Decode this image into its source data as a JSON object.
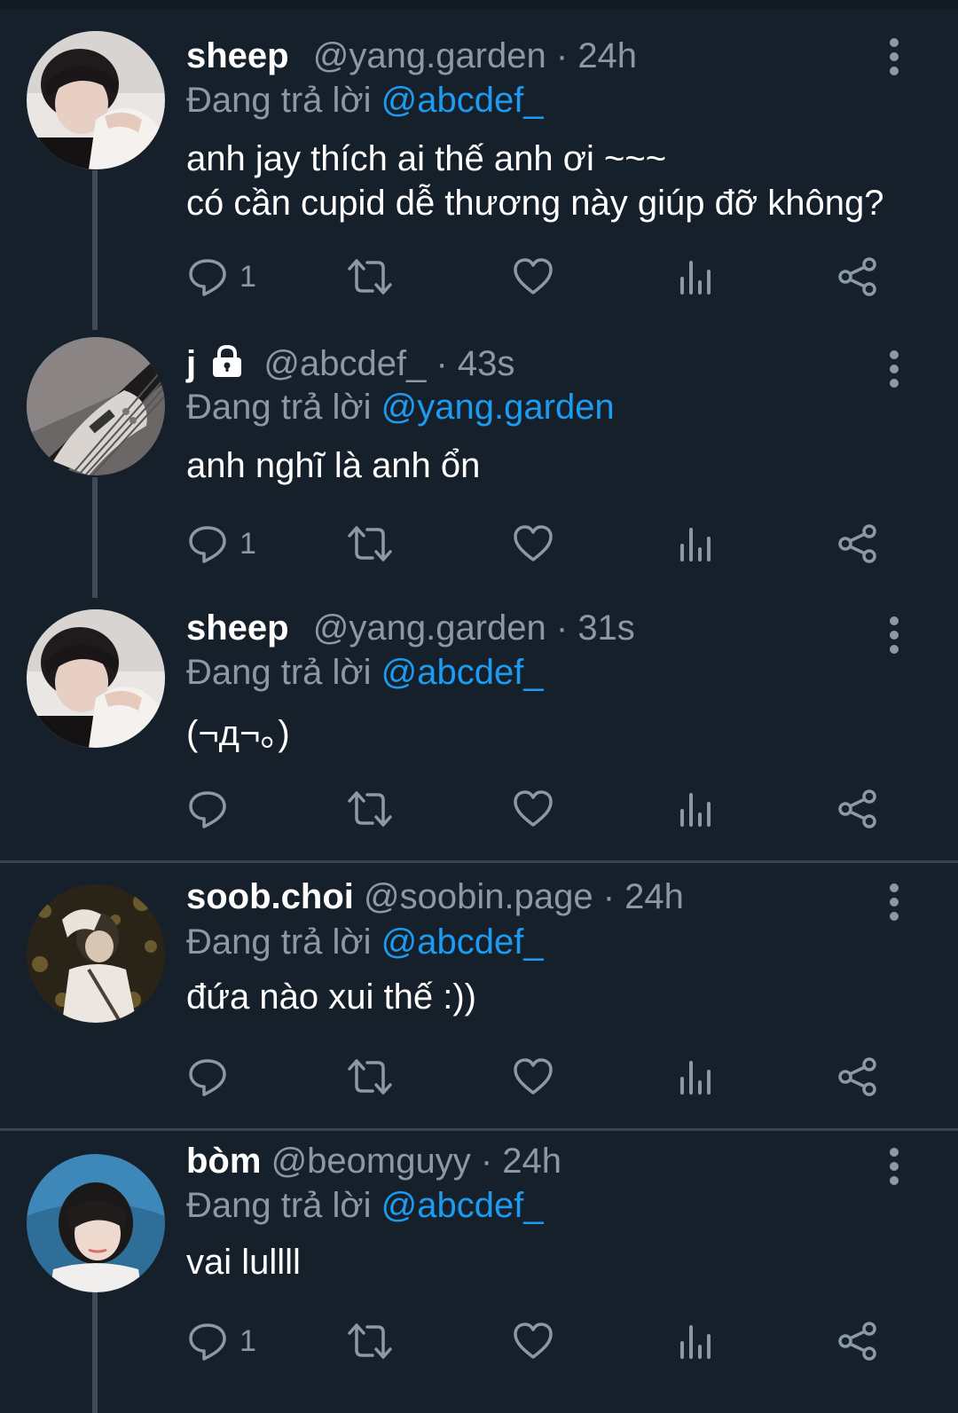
{
  "tweets": [
    {
      "name": "sheep",
      "handle": "@yang.garden",
      "time": "24h",
      "reply_prefix": "Đang trả lời",
      "reply_to": "@abcdef_",
      "text": "anh jay thích ai thế anh ơi ~~~\ncó cần cupid dễ thương này giúp đỡ không?",
      "reply_count": "1",
      "locked": false,
      "avatar": "avatar-sheep"
    },
    {
      "name": "j",
      "handle": "@abcdef_",
      "time": "43s",
      "reply_prefix": "Đang trả lời",
      "reply_to": "@yang.garden",
      "text": "anh nghĩ là anh ổn",
      "reply_count": "1",
      "locked": true,
      "avatar": "avatar-guitar"
    },
    {
      "name": "sheep",
      "handle": "@yang.garden",
      "time": "31s",
      "reply_prefix": "Đang trả lời",
      "reply_to": "@abcdef_",
      "text": "(¬д¬。)",
      "reply_count": "",
      "locked": false,
      "avatar": "avatar-sheep"
    },
    {
      "name": "soob.choi",
      "handle": "@soobin.page",
      "time": "24h",
      "reply_prefix": "Đang trả lời",
      "reply_to": "@abcdef_",
      "text": "đứa nào xui thế :))",
      "reply_count": "",
      "locked": false,
      "avatar": "avatar-soob"
    },
    {
      "name": "bòm",
      "handle": "@beomguyy",
      "time": "24h",
      "reply_prefix": "Đang trả lời",
      "reply_to": "@abcdef_",
      "text": "vai lullll",
      "reply_count": "1",
      "locked": false,
      "avatar": "avatar-beom"
    }
  ],
  "separator": "·",
  "icons": {
    "reply": "reply-icon",
    "retweet": "retweet-icon",
    "like": "heart-icon",
    "views": "analytics-icon",
    "share": "share-icon",
    "more": "more-vertical-icon",
    "lock": "lock-icon"
  },
  "colors": {
    "background": "#15202b",
    "text": "#ffffff",
    "muted": "#8b98a5",
    "link": "#1d9bf0",
    "divider": "#38444d"
  }
}
